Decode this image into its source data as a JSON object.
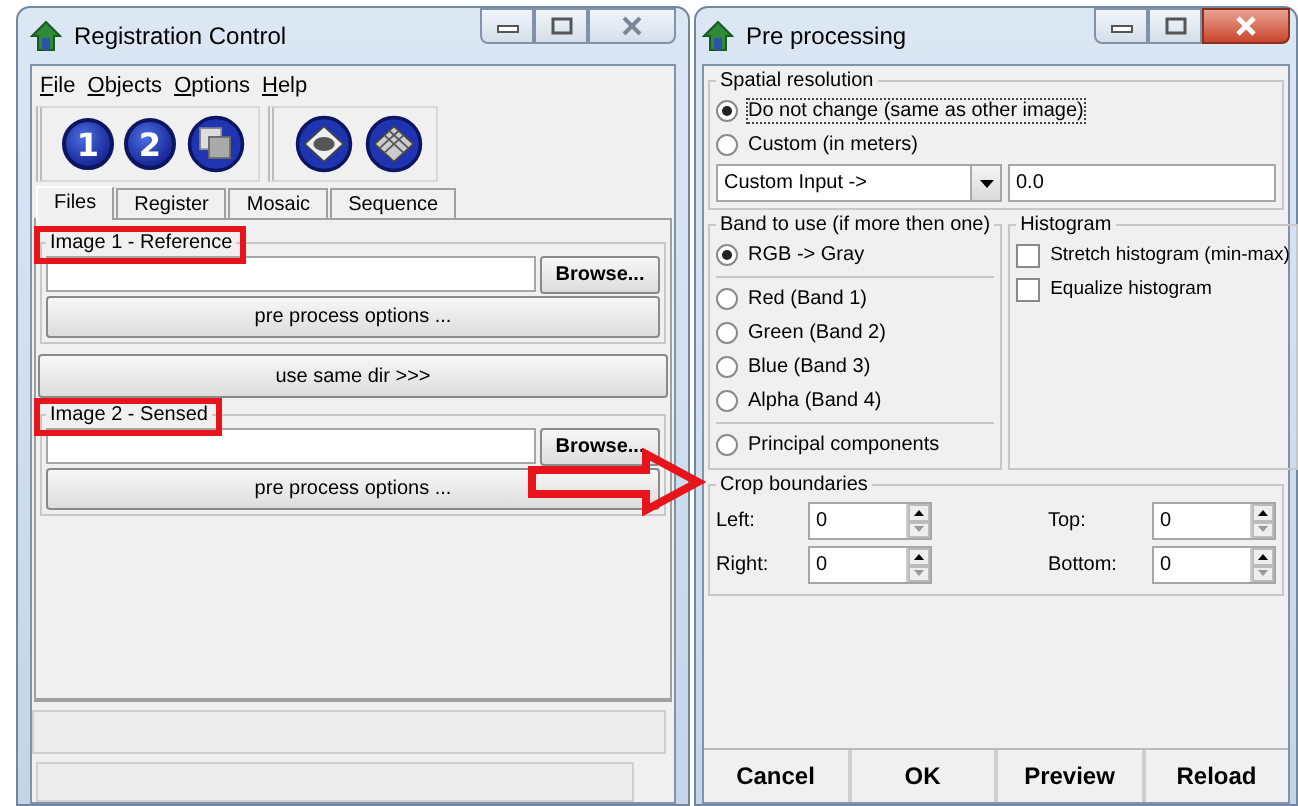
{
  "registration_window": {
    "title": "Registration Control",
    "menu": [
      "File",
      "Objects",
      "Options",
      "Help"
    ],
    "toolbar": [
      {
        "kind": "number",
        "label": "1"
      },
      {
        "kind": "number",
        "label": "2"
      },
      {
        "kind": "layers"
      },
      {
        "kind": "lens"
      },
      {
        "kind": "grid"
      }
    ],
    "tabs": [
      {
        "label": "Files",
        "selected": true
      },
      {
        "label": "Register",
        "selected": false
      },
      {
        "label": "Mosaic",
        "selected": false
      },
      {
        "label": "Sequence",
        "selected": false
      }
    ],
    "image_groups": [
      {
        "title": "Image 1 - Reference",
        "highlighted": true,
        "browse_button": "Browse...",
        "options_button": "pre process options ..."
      },
      {
        "title": "Image 2 - Sensed",
        "highlighted": true,
        "browse_button": "Browse...",
        "options_button": "pre process options ..."
      }
    ],
    "same_dir_button": "use same dir >>>"
  },
  "pointer_arrow": true,
  "preprocessing_window": {
    "title": "Pre processing",
    "spatial_resolution": {
      "title": "Spatial resolution",
      "options": [
        {
          "label": "Do not change (same as other image)",
          "selected": true
        },
        {
          "label": "Custom (in meters)",
          "selected": false
        }
      ],
      "dropdown": "Custom Input ->",
      "value": "0.0"
    },
    "band": {
      "title": "Band to use (if more then one)",
      "options": [
        {
          "label": "RGB -> Gray",
          "selected": true
        },
        {
          "label": "Red (Band 1)",
          "selected": false
        },
        {
          "label": "Green (Band 2)",
          "selected": false
        },
        {
          "label": "Blue (Band 3)",
          "selected": false
        },
        {
          "label": "Alpha (Band 4)",
          "selected": false
        },
        {
          "label": "Principal components",
          "selected": false
        }
      ]
    },
    "histogram": {
      "title": "Histogram",
      "options": [
        {
          "label": "Stretch histogram (min-max)",
          "checked": false
        },
        {
          "label": "Equalize histogram",
          "checked": false
        }
      ]
    },
    "crop": {
      "title": "Crop boundaries",
      "fields": [
        {
          "label": "Left:",
          "value": "0"
        },
        {
          "label": "Top:",
          "value": "0"
        },
        {
          "label": "Right:",
          "value": "0"
        },
        {
          "label": "Bottom:",
          "value": "0"
        }
      ]
    },
    "buttons": [
      "Cancel",
      "OK",
      "Preview",
      "Reload"
    ]
  }
}
